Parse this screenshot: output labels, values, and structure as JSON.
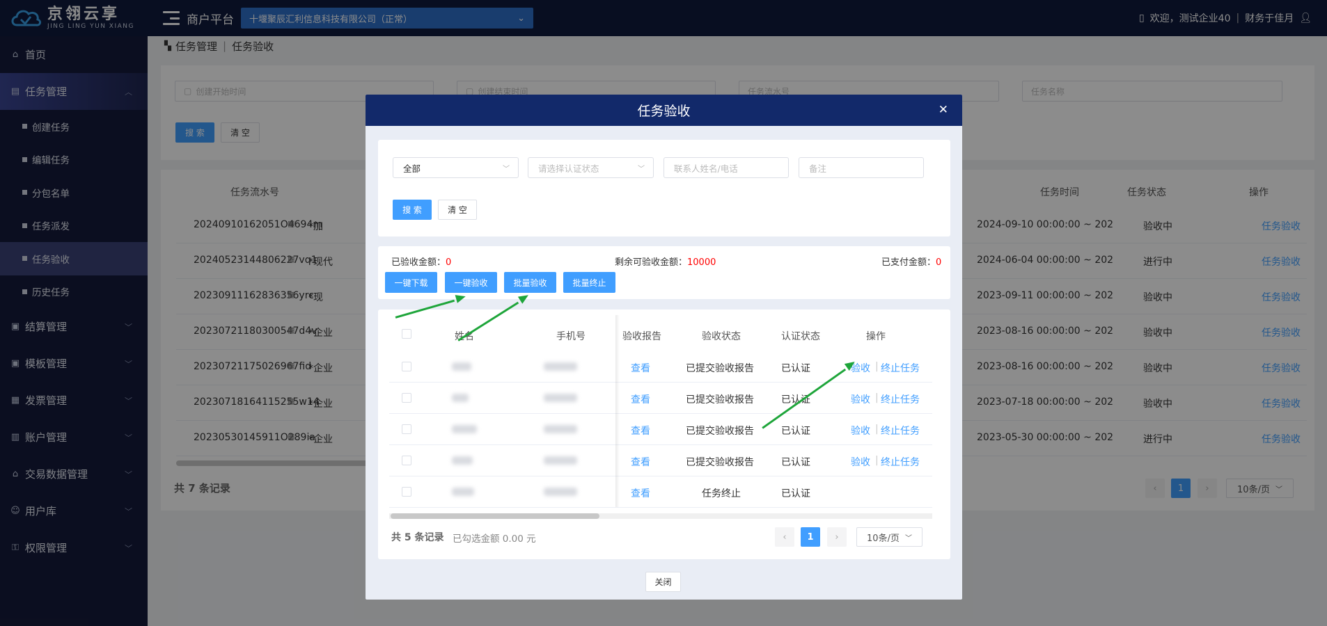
{
  "header": {
    "logo_cn": "京翎云享",
    "logo_en": "JING LING YUN XIANG",
    "platform": "商户平台",
    "company": "十堰聚辰汇利信息科技有限公司（正常）",
    "welcome": "欢迎，测试企业40",
    "user": "财务于佳月"
  },
  "sidebar": {
    "home": "首页",
    "task_mgmt": "任务管理",
    "sub_items": [
      "创建任务",
      "编辑任务",
      "分包名单",
      "任务派发",
      "任务验收",
      "历史任务"
    ],
    "other_items": [
      "结算管理",
      "模板管理",
      "发票管理",
      "账户管理",
      "交易数据管理",
      "用户库",
      "权限管理"
    ]
  },
  "breadcrumb": {
    "level1": "任务管理",
    "level2": "任务验收"
  },
  "bg_search": {
    "start_placeholder": "创建开始时间",
    "end_placeholder": "创建结束时间",
    "serial_placeholder": "任务流水号",
    "name_placeholder": "任务名称",
    "search": "搜 索",
    "clear": "清 空"
  },
  "bg_table": {
    "headers": {
      "serial": "任务流水号",
      "time": "任务时间",
      "status": "任务状态",
      "op": "操作"
    },
    "rows": [
      {
        "serial": "20240910162051O4694m",
        "name": "*加",
        "time": "2024-09-10 00:00:00 ~ 202",
        "status": "验收中",
        "op": "任务验收"
      },
      {
        "serial": "20240523144806227vq1",
        "name": "*现代",
        "time": "2024-06-04 00:00:00 ~ 202",
        "status": "进行中",
        "op": "任务验收"
      },
      {
        "serial": "20230911162836356yrc",
        "name": "*现",
        "time": "2023-09-11 00:00:00 ~ 202",
        "status": "验收中",
        "op": "任务验收"
      },
      {
        "serial": "20230721180300547d4v",
        "name": "*企业",
        "time": "2023-08-16 00:00:00 ~ 202",
        "status": "验收中",
        "op": "任务验收"
      },
      {
        "serial": "20230721175026967fid",
        "name": "*企业",
        "time": "2023-08-16 00:00:00 ~ 202",
        "status": "验收中",
        "op": "任务验收"
      },
      {
        "serial": "20230718164115255w14",
        "name": "*企业",
        "time": "2023-07-18 00:00:00 ~ 202",
        "status": "验收中",
        "op": "任务验收"
      },
      {
        "serial": "20230530145911O289ia",
        "name": "*企业",
        "time": "2023-05-30 00:00:00 ~ 202",
        "status": "进行中",
        "op": "任务验收"
      }
    ],
    "total": "共 7 条记录",
    "page": "1",
    "page_size": "10条/页"
  },
  "modal": {
    "title": "任务验收",
    "filters": {
      "all": "全部",
      "auth_placeholder": "请选择认证状态",
      "contact_placeholder": "联系人姓名/电话",
      "remark_placeholder": "备注",
      "search": "搜 索",
      "clear": "清 空"
    },
    "summary": {
      "accepted_label": "已验收金额：",
      "accepted_value": "0",
      "remaining_label": "剩余可验收金额：",
      "remaining_value": "10000",
      "paid_label": "已支付金额：",
      "paid_value": "0"
    },
    "actions": [
      "一键下载",
      "一键验收",
      "批量验收",
      "批量终止"
    ],
    "table": {
      "headers": {
        "name": "姓名",
        "phone": "手机号",
        "report": "验收报告",
        "accept_status": "验收状态",
        "auth_status": "认证状态",
        "op": "操作"
      },
      "rows": [
        {
          "report": "查看",
          "accept_status": "已提交验收报告",
          "auth": "已认证",
          "op1": "验收",
          "op2": "终止任务"
        },
        {
          "report": "查看",
          "accept_status": "已提交验收报告",
          "auth": "已认证",
          "op1": "验收",
          "op2": "终止任务"
        },
        {
          "report": "查看",
          "accept_status": "已提交验收报告",
          "auth": "已认证",
          "op1": "验收",
          "op2": "终止任务"
        },
        {
          "report": "查看",
          "accept_status": "已提交验收报告",
          "auth": "已认证",
          "op1": "验收",
          "op2": "终止任务"
        },
        {
          "report": "查看",
          "accept_status": "任务终止",
          "auth": "已认证",
          "op1": "",
          "op2": ""
        }
      ]
    },
    "footer": {
      "total": "共 5 条记录",
      "selected": "已勾选金额 0.00 元",
      "page": "1",
      "page_size": "10条/页",
      "close": "关闭"
    }
  },
  "colors": {
    "accent": "#409eff",
    "header_bg": "#0f1a3c",
    "modal_header": "#12296a",
    "sidebar_bg": "#151b3b",
    "arrow": "#1ea53a",
    "red": "#ff0000"
  }
}
